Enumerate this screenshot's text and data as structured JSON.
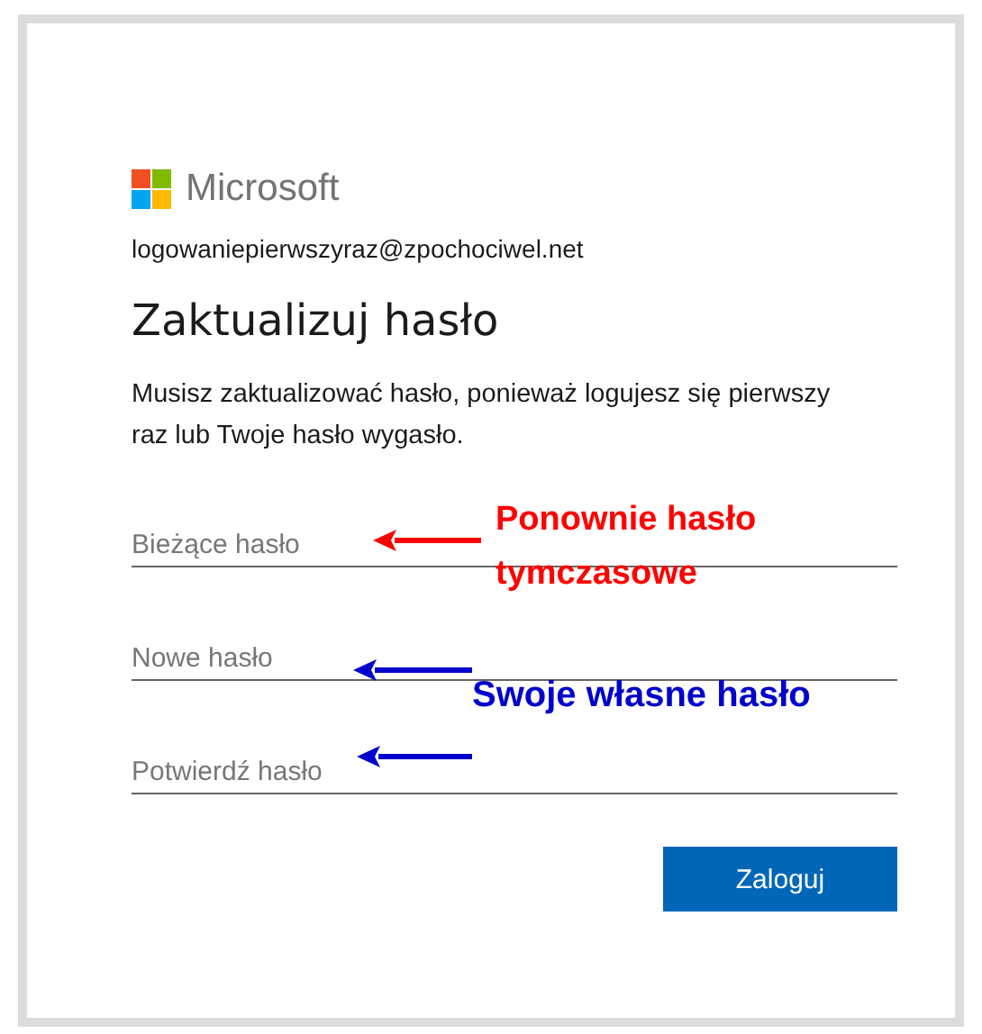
{
  "brand": {
    "name": "Microsoft"
  },
  "account": "logowaniepierwszyraz@zpochociwel.net",
  "heading": "Zaktualizuj hasło",
  "message": "Musisz zaktualizować hasło, ponieważ logujesz się pierwszy raz lub Twoje hasło wygasło.",
  "fields": [
    {
      "placeholder": "Bieżące hasło"
    },
    {
      "placeholder": "Nowe hasło"
    },
    {
      "placeholder": "Potwierdź hasło"
    }
  ],
  "button": "Zaloguj",
  "annotations": [
    {
      "text": "Ponownie hasło tymczasowe",
      "color": "#ff0000"
    },
    {
      "text": "Swoje własne hasło",
      "color": "#0000cc"
    }
  ],
  "arrows": [
    {
      "color": "#ff0000"
    },
    {
      "color": "#0000cc"
    },
    {
      "color": "#0000cc"
    }
  ]
}
